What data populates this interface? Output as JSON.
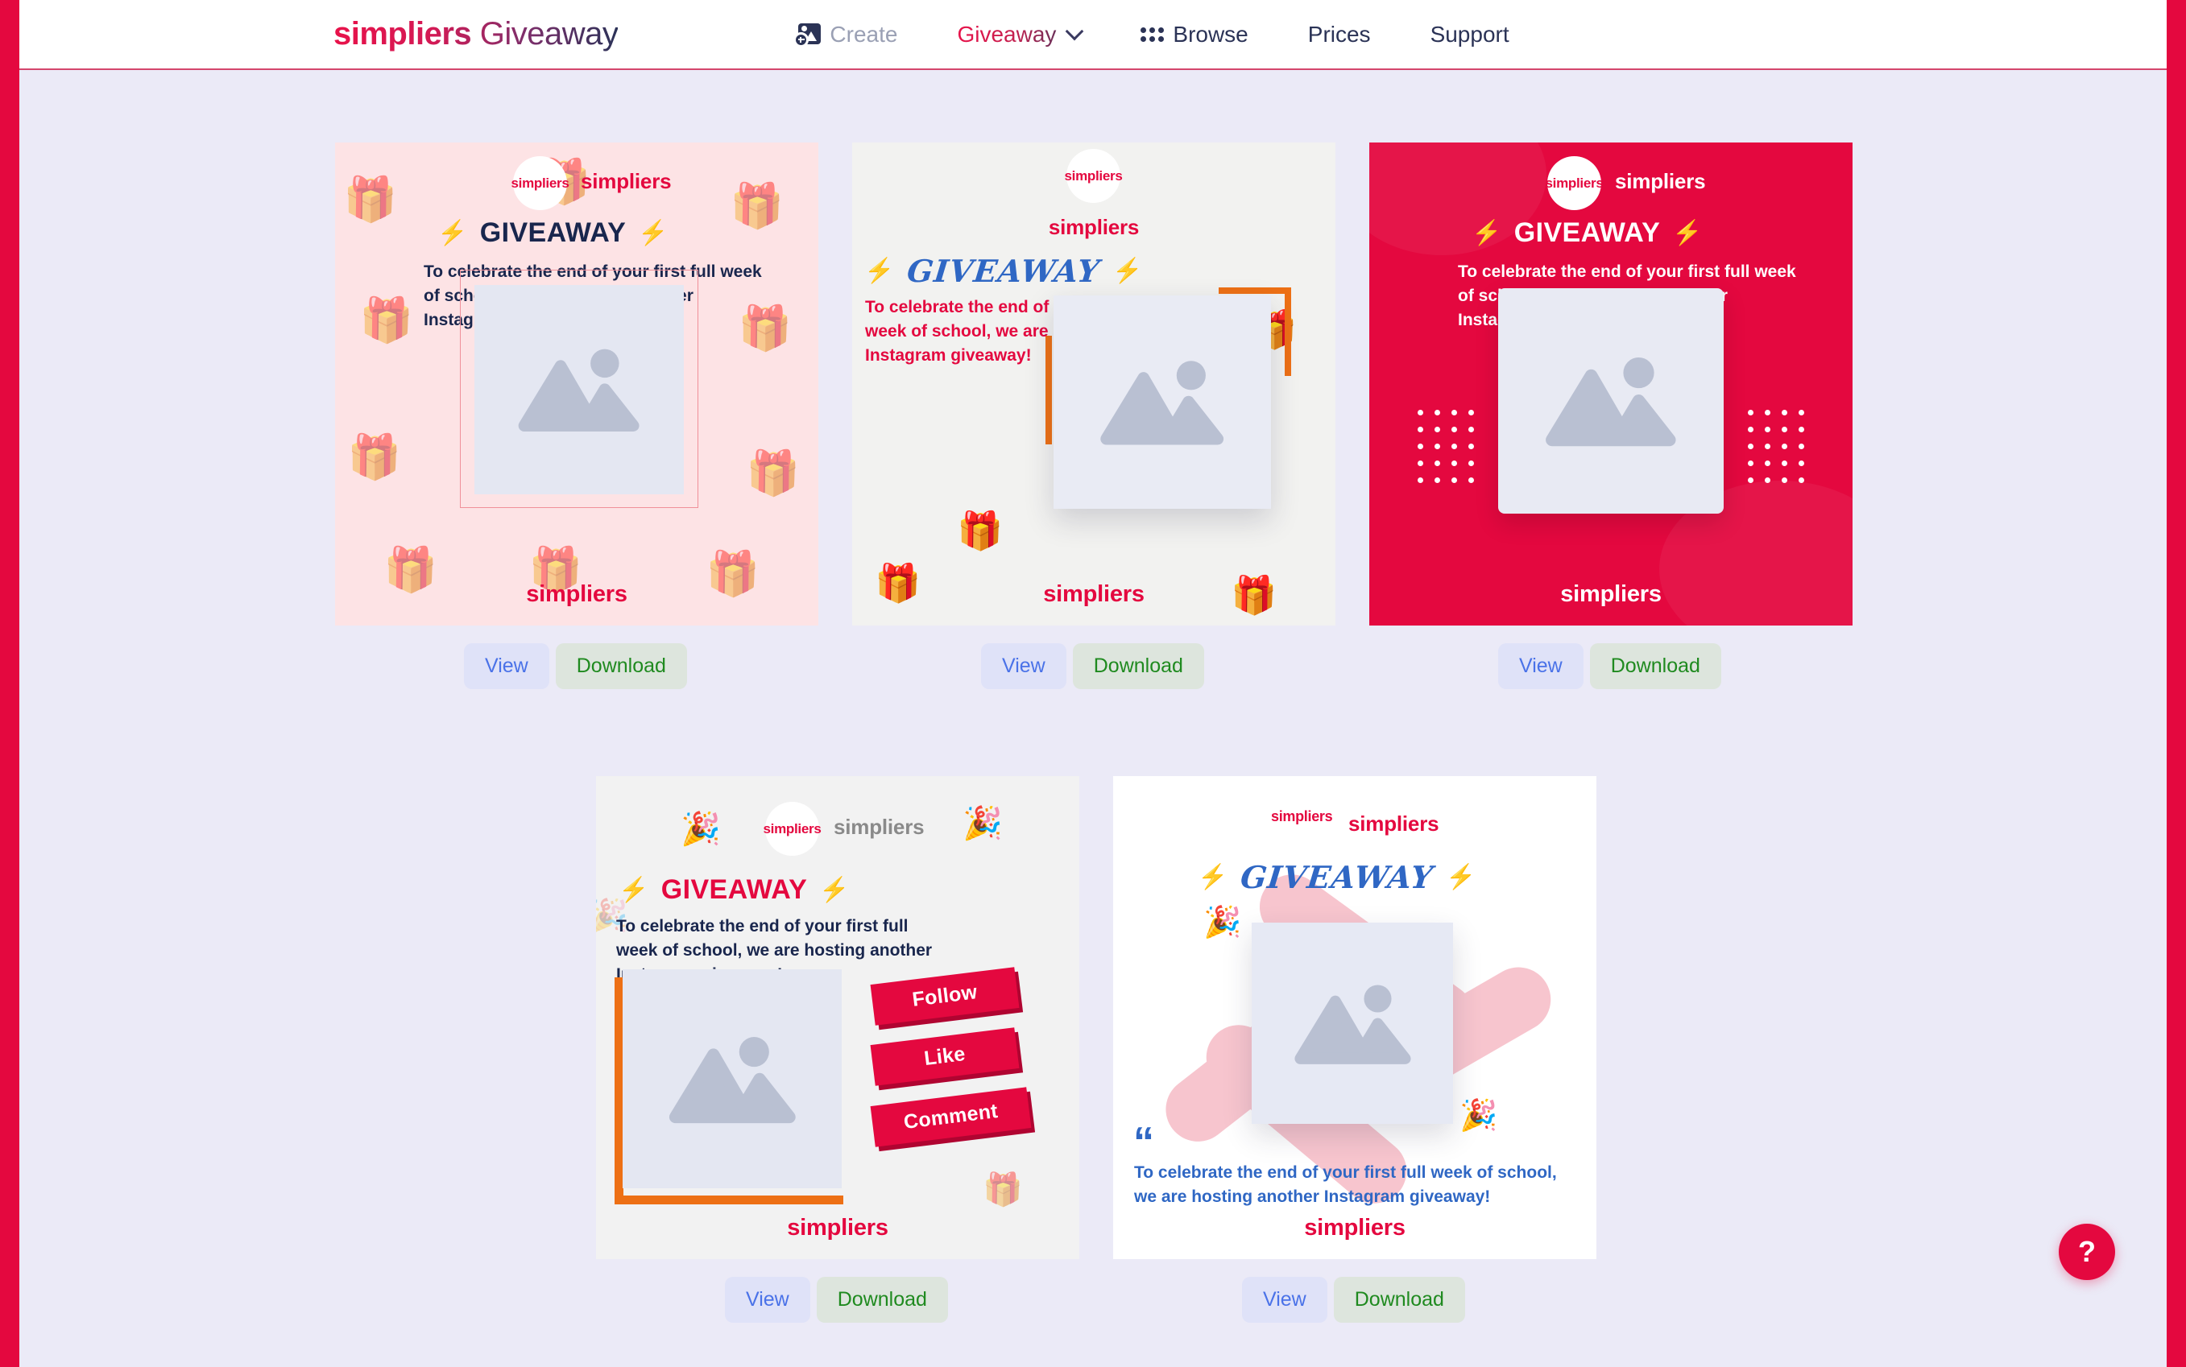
{
  "header": {
    "brand_strong": "simpliers",
    "brand_light": "Giveaway",
    "nav": [
      {
        "label": "Create",
        "icon": "create-image-icon"
      },
      {
        "label": "Giveaway",
        "icon": "chevron-down-icon"
      },
      {
        "label": "Browse",
        "icon": "grid-dots-icon"
      },
      {
        "label": "Prices",
        "icon": ""
      },
      {
        "label": "Support",
        "icon": ""
      }
    ]
  },
  "buttons": {
    "view": "View",
    "download": "Download"
  },
  "help": {
    "label": "?",
    "name": "help-icon"
  },
  "colors": {
    "brand_red": "#e4083f",
    "navy": "#19264d",
    "blue": "#2f67c4",
    "orange": "#ed7015",
    "page_bg": "#ebeaf7",
    "view_text": "#4a72e8",
    "download_text": "#1f8a1f"
  },
  "templates": [
    {
      "id": "template-pink-gift-pattern",
      "avatar_text": "simpliers",
      "handle_top": "simpliers",
      "giveaway_title": "GIVEAWAY",
      "bolt": "⚡",
      "description": "To celebrate the end of your first full week of school, we are hosting another Instagram giveaway!",
      "handle_bottom": "simpliers",
      "bg": "#fde3e5"
    },
    {
      "id": "template-grey-gift-outline",
      "avatar_text": "simpliers",
      "handle_top": "simpliers",
      "giveaway_title": "GIVEAWAY",
      "bolt": "⚡",
      "description": "To celebrate the end of your first full week of school, we are hosting another Instagram giveaway!",
      "handle_bottom": "simpliers",
      "bg": "#f2f2f0"
    },
    {
      "id": "template-crimson-dots",
      "avatar_text": "simpliers",
      "handle_top": "simpliers",
      "giveaway_title": "GIVEAWAY",
      "bolt": "⚡",
      "description": "To celebrate the end of your first full week of school, we are hosting another Instagram giveaway!",
      "handle_bottom": "simpliers",
      "bg": "#e4083f"
    },
    {
      "id": "template-follow-like-comment",
      "avatar_text": "simpliers",
      "handle_top": "simpliers",
      "giveaway_title": "GIVEAWAY",
      "bolt": "⚡",
      "description": "To celebrate the end of your first full week of school, we are hosting another Instagram giveaway!",
      "handle_bottom": "simpliers",
      "tags": [
        "Follow",
        "Like",
        "Comment"
      ],
      "bg": "#f2f2f2"
    },
    {
      "id": "template-white-pink-blob",
      "avatar_text": "simpliers",
      "handle_top": "simpliers",
      "giveaway_title": "GIVEAWAY",
      "bolt": "⚡",
      "quote_mark": "“",
      "description": "To celebrate the end of your first full week of school, we are hosting another Instagram giveaway!",
      "handle_bottom": "simpliers",
      "bg": "#ffffff"
    }
  ]
}
